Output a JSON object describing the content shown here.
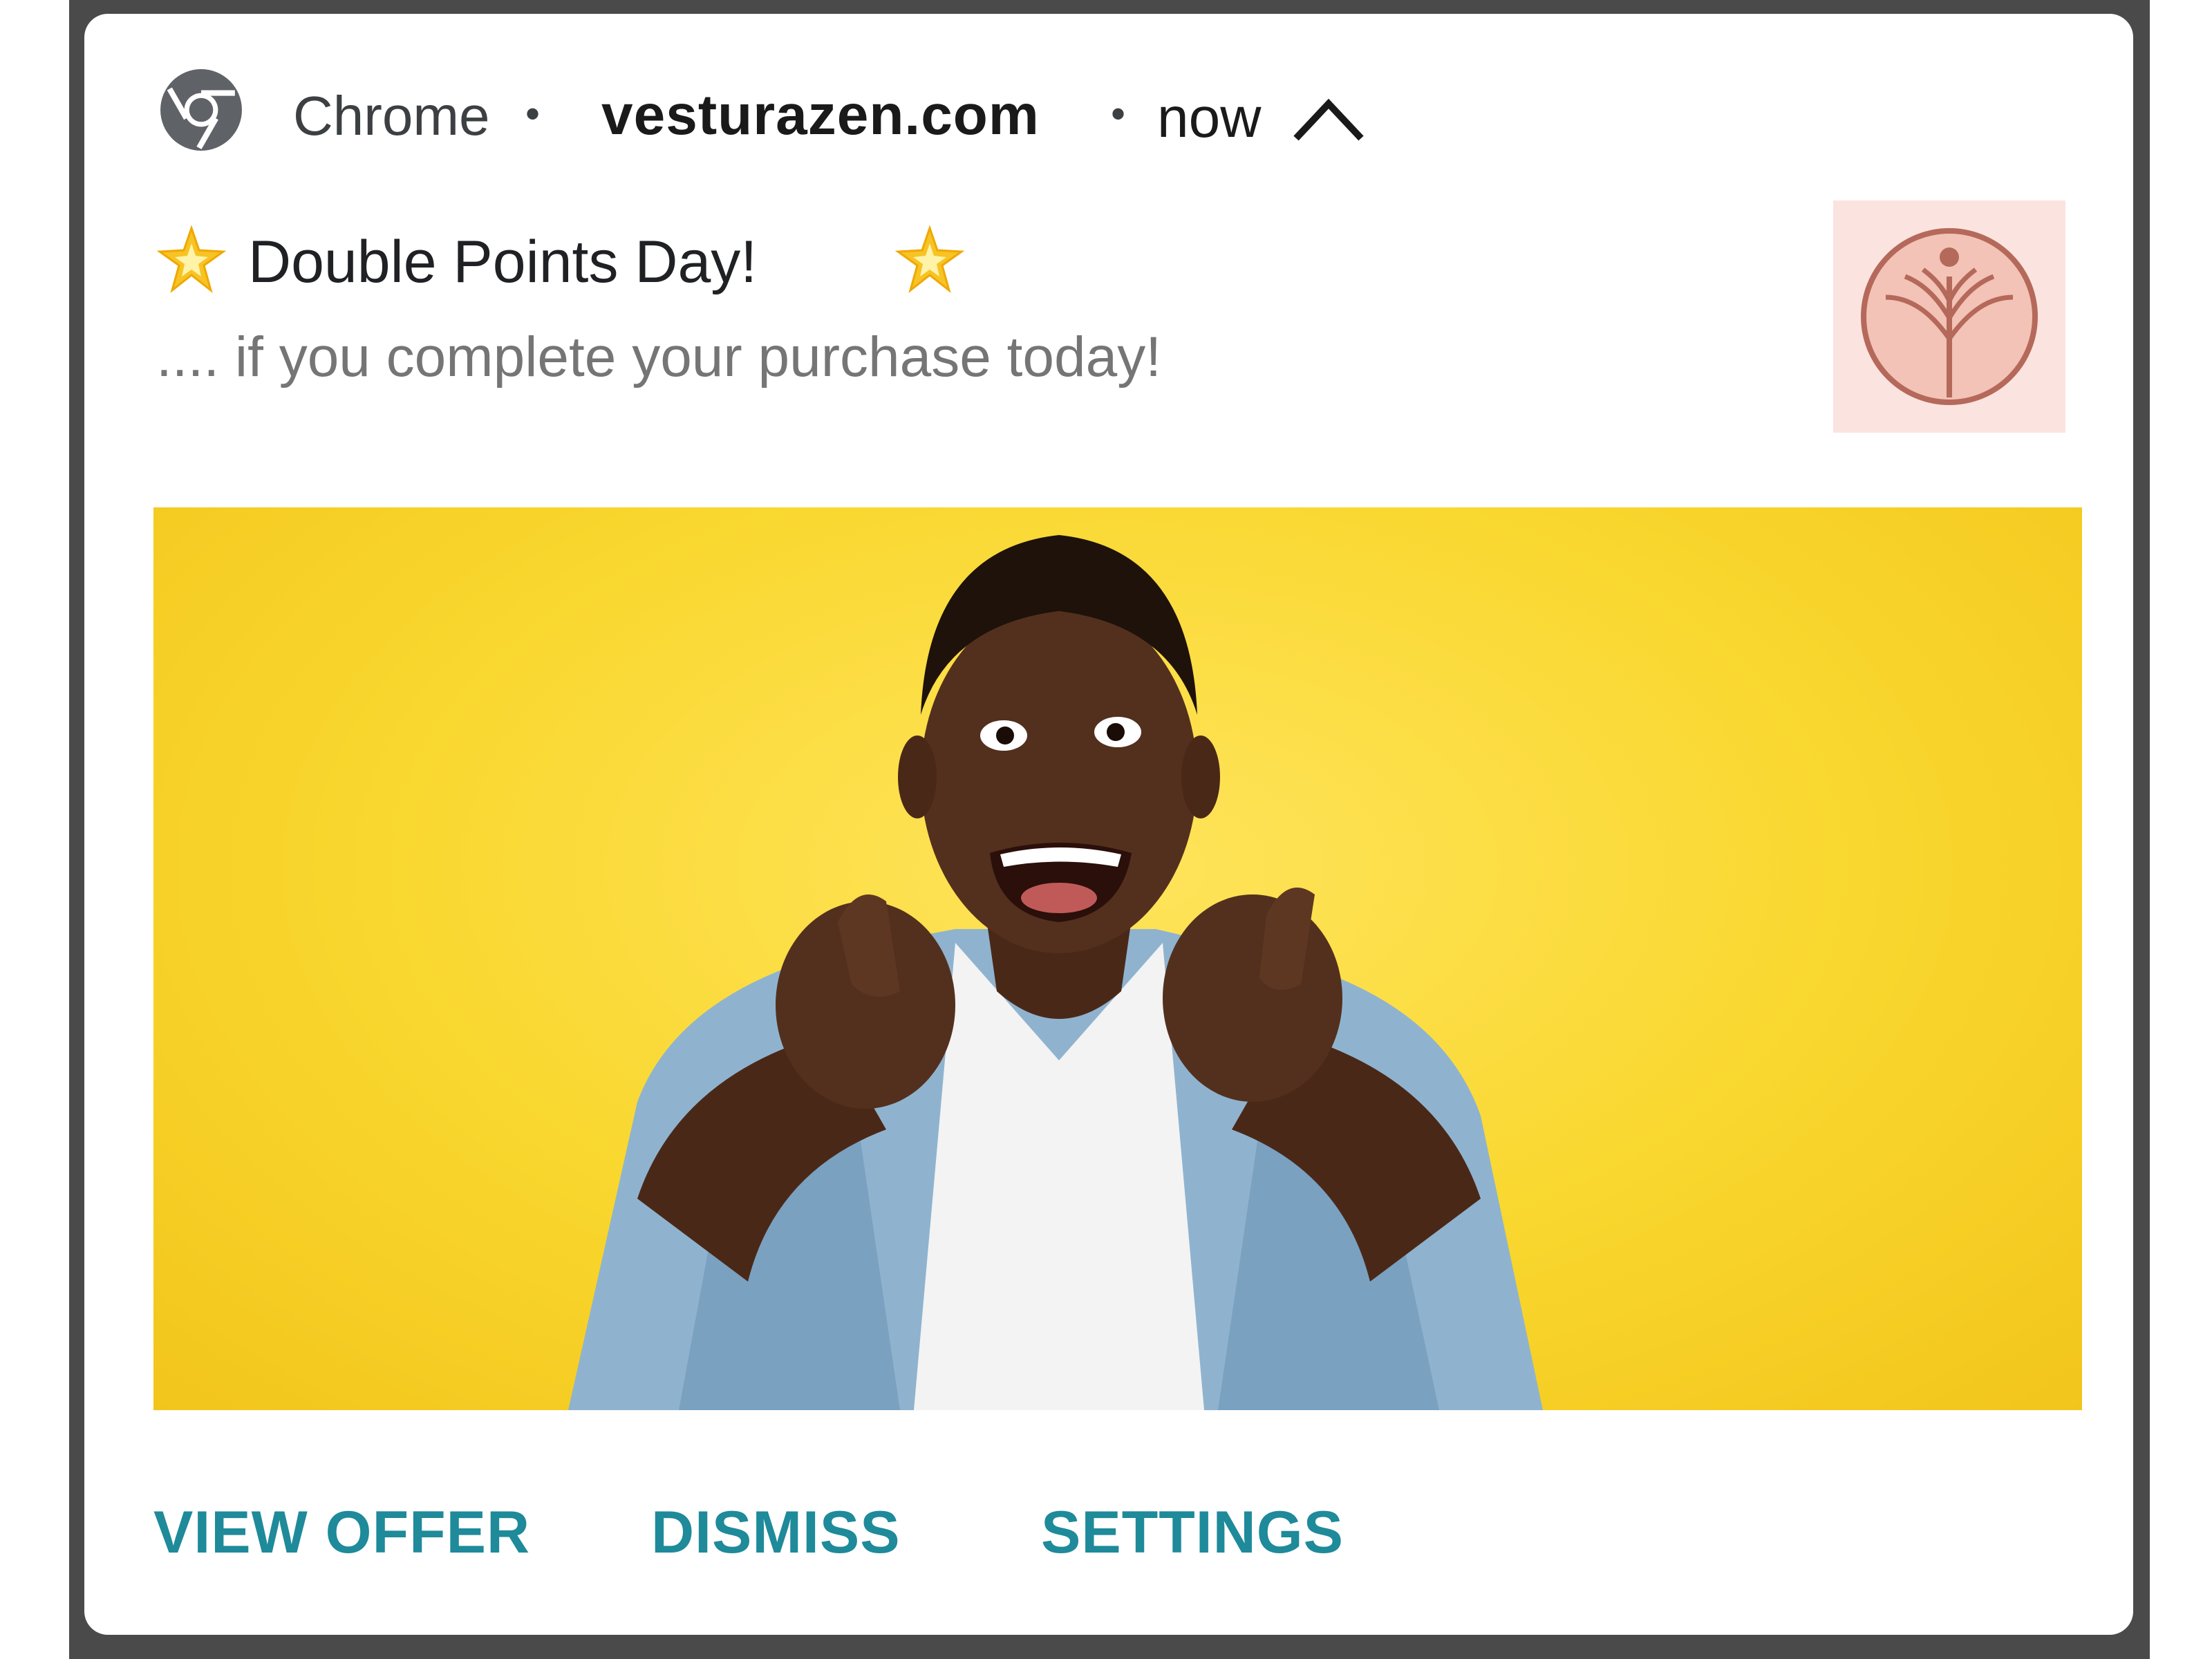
{
  "notification": {
    "app_name": "Chrome",
    "separator": "•",
    "domain": "vesturazen.com",
    "time": "now",
    "title": "Double Points Day!",
    "body": ".... if you complete your purchase today!",
    "icons": {
      "app": "chrome-icon",
      "expand": "chevron-up-icon",
      "title_decoration": "sparkle-star-icon",
      "brand_logo": "tree-logo-icon"
    },
    "hero_image": "smiling man in denim shirt pointing at viewer on yellow background",
    "actions": [
      {
        "label": "VIEW OFFER"
      },
      {
        "label": "DISMISS"
      },
      {
        "label": "SETTINGS"
      }
    ]
  },
  "colors": {
    "frame": "#4a4a4a",
    "card_background": "#ffffff",
    "title_text": "#202124",
    "body_text": "#757575",
    "action_text": "#1e8a9a",
    "hero_background": "#f9d72e",
    "logo_background": "#fbe3e0",
    "logo_stroke": "#b5695a"
  }
}
